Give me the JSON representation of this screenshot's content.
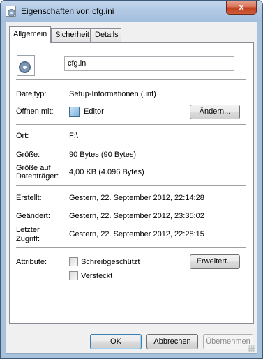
{
  "window": {
    "title": "Eigenschaften von cfg.ini",
    "close_glyph": "x"
  },
  "tabs": [
    {
      "label": "Allgemein",
      "active": true
    },
    {
      "label": "Sicherheit",
      "active": false
    },
    {
      "label": "Details",
      "active": false
    }
  ],
  "general": {
    "file_icon": "config-file-icon",
    "filename": "cfg.ini",
    "filetype_label": "Dateityp:",
    "filetype_value": "Setup-Informationen (.inf)",
    "opens_with_label": "Öffnen mit:",
    "opens_with_value": "Editor",
    "opens_with_icon": "notepad-icon",
    "change_button": "Ändern...",
    "location_label": "Ort:",
    "location_value": "F:\\",
    "size_label": "Größe:",
    "size_value": "90 Bytes (90 Bytes)",
    "size_on_disk_label_1": "Größe auf",
    "size_on_disk_label_2": "Datenträger:",
    "size_on_disk_value": "4,00 KB (4.096 Bytes)",
    "created_label": "Erstellt:",
    "created_value": "Gestern, 22. September 2012, 22:14:28",
    "modified_label": "Geändert:",
    "modified_value": "Gestern, 22. September 2012, 23:35:02",
    "accessed_label_1": "Letzter",
    "accessed_label_2": "Zugriff:",
    "accessed_value": "Gestern, 22. September 2012, 22:28:15",
    "attributes_label": "Attribute:",
    "readonly_label": "Schreibgeschützt",
    "readonly_checked": false,
    "hidden_label": "Versteckt",
    "hidden_checked": false,
    "advanced_button": "Erweitert..."
  },
  "footer": {
    "ok": "OK",
    "cancel": "Abbrechen",
    "apply": "Übernehmen"
  }
}
